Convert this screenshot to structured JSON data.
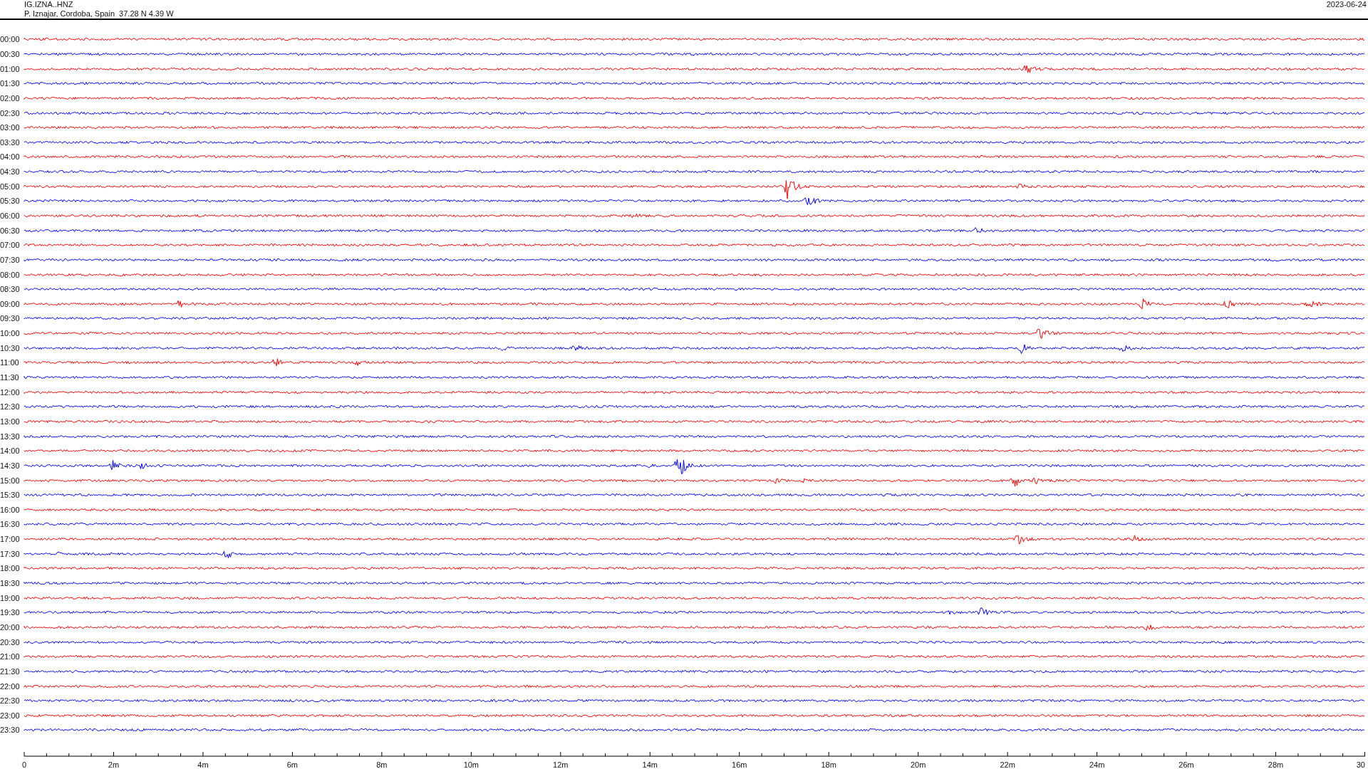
{
  "header": {
    "station": "IG.IZNA..HNZ",
    "location": "P. Iznajar, Cordoba, Spain  37.28 N 4.39 W",
    "date": "2023-06-24"
  },
  "rows": [
    {
      "time": "00:00",
      "color": "#ff0000"
    },
    {
      "time": "00:30",
      "color": "#0000ff"
    },
    {
      "time": "01:00",
      "color": "#ff0000"
    },
    {
      "time": "01:30",
      "color": "#0000ff"
    },
    {
      "time": "02:00",
      "color": "#ff0000"
    },
    {
      "time": "02:30",
      "color": "#0000ff"
    },
    {
      "time": "03:00",
      "color": "#ff0000"
    },
    {
      "time": "03:30",
      "color": "#0000ff"
    },
    {
      "time": "04:00",
      "color": "#ff0000"
    },
    {
      "time": "04:30",
      "color": "#0000ff"
    },
    {
      "time": "05:00",
      "color": "#ff0000"
    },
    {
      "time": "05:30",
      "color": "#0000ff"
    },
    {
      "time": "06:00",
      "color": "#ff0000"
    },
    {
      "time": "06:30",
      "color": "#0000ff"
    },
    {
      "time": "07:00",
      "color": "#ff0000"
    },
    {
      "time": "07:30",
      "color": "#0000ff"
    },
    {
      "time": "08:00",
      "color": "#ff0000"
    },
    {
      "time": "08:30",
      "color": "#0000ff"
    },
    {
      "time": "09:00",
      "color": "#ff0000"
    },
    {
      "time": "09:30",
      "color": "#0000ff"
    },
    {
      "time": "10:00",
      "color": "#ff0000"
    },
    {
      "time": "10:30",
      "color": "#0000ff"
    },
    {
      "time": "11:00",
      "color": "#ff0000"
    },
    {
      "time": "11:30",
      "color": "#0000ff"
    },
    {
      "time": "12:00",
      "color": "#ff0000"
    },
    {
      "time": "12:30",
      "color": "#0000ff"
    },
    {
      "time": "13:00",
      "color": "#ff0000"
    },
    {
      "time": "13:30",
      "color": "#0000ff"
    },
    {
      "time": "14:00",
      "color": "#ff0000"
    },
    {
      "time": "14:30",
      "color": "#0000ff"
    },
    {
      "time": "15:00",
      "color": "#ff0000"
    },
    {
      "time": "15:30",
      "color": "#0000ff"
    },
    {
      "time": "16:00",
      "color": "#ff0000"
    },
    {
      "time": "16:30",
      "color": "#0000ff"
    },
    {
      "time": "17:00",
      "color": "#ff0000"
    },
    {
      "time": "17:30",
      "color": "#0000ff"
    },
    {
      "time": "18:00",
      "color": "#ff0000"
    },
    {
      "time": "18:30",
      "color": "#0000ff"
    },
    {
      "time": "19:00",
      "color": "#ff0000"
    },
    {
      "time": "19:30",
      "color": "#0000ff"
    },
    {
      "time": "20:00",
      "color": "#ff0000"
    },
    {
      "time": "20:30",
      "color": "#0000ff"
    },
    {
      "time": "21:00",
      "color": "#ff0000"
    },
    {
      "time": "21:30",
      "color": "#0000ff"
    },
    {
      "time": "22:00",
      "color": "#ff0000"
    },
    {
      "time": "22:30",
      "color": "#0000ff"
    },
    {
      "time": "23:00",
      "color": "#ff0000"
    },
    {
      "time": "23:30",
      "color": "#0000ff"
    }
  ],
  "axis_labels": [
    "0",
    "2m",
    "4m",
    "6m",
    "8m",
    "10m",
    "12m",
    "14m",
    "16m",
    "18m",
    "20m",
    "22m",
    "24m",
    "26m",
    "28m",
    "30"
  ]
}
